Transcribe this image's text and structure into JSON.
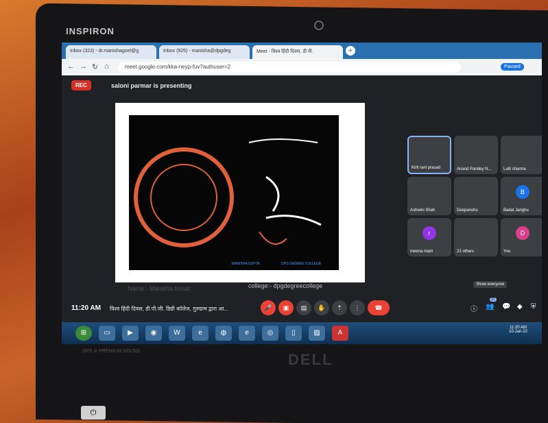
{
  "laptop": {
    "brand": "INSPIRON",
    "logo": "DELL",
    "sticker": "SRS ⊘ PREMIUM SOUND"
  },
  "browser": {
    "tabs": [
      "Inbox (323) - dr.manishagoel@g",
      "Inbox (925) - manisha@dpgdeg",
      "Meet - विश्व हिंदी दिवस, डी.पी."
    ],
    "url": "meet.google.com/kka-neyp-fuv?authuser=2",
    "profile": "Paused"
  },
  "meet": {
    "rec_label": "REC",
    "presenting": "saloni parmar is presenting",
    "slide_credit_left": "MANISHA GUPTA",
    "slide_credit_right": "DPG DEGREE COLLEGE",
    "slide_caption_left": "Name:- Manisha tomar",
    "slide_caption_right": "college:- dpgdegreecollege",
    "participants": [
      {
        "name": "Kirti rani prasad",
        "initial": ""
      },
      {
        "name": "Anand Pandey N...",
        "initial": ""
      },
      {
        "name": "Lalit sharma",
        "initial": ""
      },
      {
        "name": "Ashwini Shah",
        "initial": ""
      },
      {
        "name": "Deepanshu",
        "initial": ""
      },
      {
        "name": "Badal Janghu",
        "initial": "B"
      },
      {
        "name": "meena mam",
        "initial": "r"
      },
      {
        "name": "22 others",
        "initial": ""
      },
      {
        "name": "You",
        "initial": "D"
      }
    ],
    "time": "11:20 AM",
    "meeting_title": "विश्व हिंदी दिवस, डी.पी.जी. डिग्री कॉलेज, गुरुग्राम द्वारा आ...",
    "tooltip": "Show everyone",
    "badge": "27"
  },
  "taskbar": {
    "time": "11:20 AM",
    "date": "10-Jan-22"
  }
}
